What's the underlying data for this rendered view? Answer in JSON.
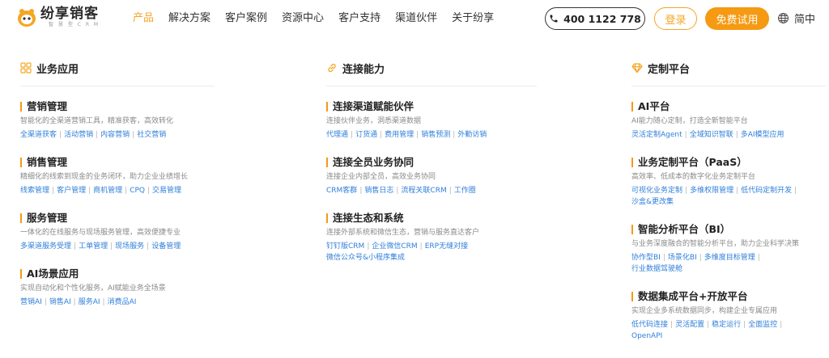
{
  "brand": {
    "name": "纷享销客",
    "subtitle": "智 慧 型 C R M"
  },
  "nav": [
    "产品",
    "解决方案",
    "客户案例",
    "资源中心",
    "客户支持",
    "渠道伙伴",
    "关于纷享"
  ],
  "nav_active_index": 0,
  "header_actions": {
    "phone": "400 1122 778",
    "login": "登录",
    "trial": "免费试用",
    "language": "简中"
  },
  "colors": {
    "accent": "#f59a12",
    "link": "#2f7fd9"
  },
  "columns": [
    {
      "icon": "grid-icon",
      "title": "业务应用",
      "items": [
        {
          "title": "营销管理",
          "desc": "智能化的全渠道营销工具，精准获客，高效转化",
          "links": [
            "全渠道获客",
            "活动营销",
            "内容营销",
            "社交营销"
          ]
        },
        {
          "title": "销售管理",
          "desc": "精细化的线索到现金的业务闭环，助力企业业绩增长",
          "links": [
            "线索管理",
            "客户管理",
            "商机管理",
            "CPQ",
            "交易管理"
          ]
        },
        {
          "title": "服务管理",
          "desc": "一体化的在线服务与现场服务管理，高效便捷专业",
          "links": [
            "多渠道服务受理",
            "工单管理",
            "现场服务",
            "设备管理"
          ]
        },
        {
          "title": "AI场景应用",
          "desc": "实现自动化和个性化服务，AI赋能业务全场景",
          "links": [
            "营销AI",
            "销售AI",
            "服务AI",
            "消费品AI"
          ]
        }
      ]
    },
    {
      "icon": "link-icon",
      "title": "连接能力",
      "items": [
        {
          "title": "连接渠道赋能伙伴",
          "desc": "连接伙伴业务，洞悉渠道数据",
          "links": [
            "代理通",
            "订货通",
            "费用管理",
            "销售预测",
            "外勤访销"
          ]
        },
        {
          "title": "连接全员业务协同",
          "desc": "连接企业内部全员，高效业务协同",
          "links": [
            "CRM客群",
            "销售日志",
            "流程关联CRM",
            "工作圈"
          ]
        },
        {
          "title": "连接生态和系统",
          "desc": "连接外部系统和微信生态，营销与服务直达客户",
          "links": [
            "钉钉版CRM",
            "企业微信CRM",
            "ERP无缝对接"
          ],
          "links_line2": [
            "微信公众号&小程序集成"
          ]
        }
      ]
    },
    {
      "icon": "diamond-icon",
      "title": "定制平台",
      "items": [
        {
          "title": "AI平台",
          "desc": "AI能力随心定制，打造全新智能平台",
          "links": [
            "灵活定制Agent",
            "全域知识智联",
            "多AI模型应用"
          ]
        },
        {
          "title": "业务定制平台（PaaS）",
          "desc": "高效率、低成本的数字化业务定制平台",
          "links": [
            "可视化业务定制",
            "多维权限管理",
            "低代码定制开发"
          ],
          "links_line2": [
            "沙盒&更改集"
          ]
        },
        {
          "title": "智能分析平台（BI）",
          "desc": "与业务深度融合的智能分析平台，助力企业科学决策",
          "links": [
            "协作型BI",
            "场景化BI",
            "多维度目标管理"
          ],
          "links_line2": [
            "行业数据驾驶舱"
          ]
        },
        {
          "title": "数据集成平台+开放平台",
          "desc": "实现企业多系统数据同步，构建企业专属应用",
          "links": [
            "低代码连接",
            "灵活配置",
            "稳定运行",
            "全面监控"
          ],
          "links_line2": [
            "OpenAPI"
          ]
        }
      ]
    }
  ]
}
